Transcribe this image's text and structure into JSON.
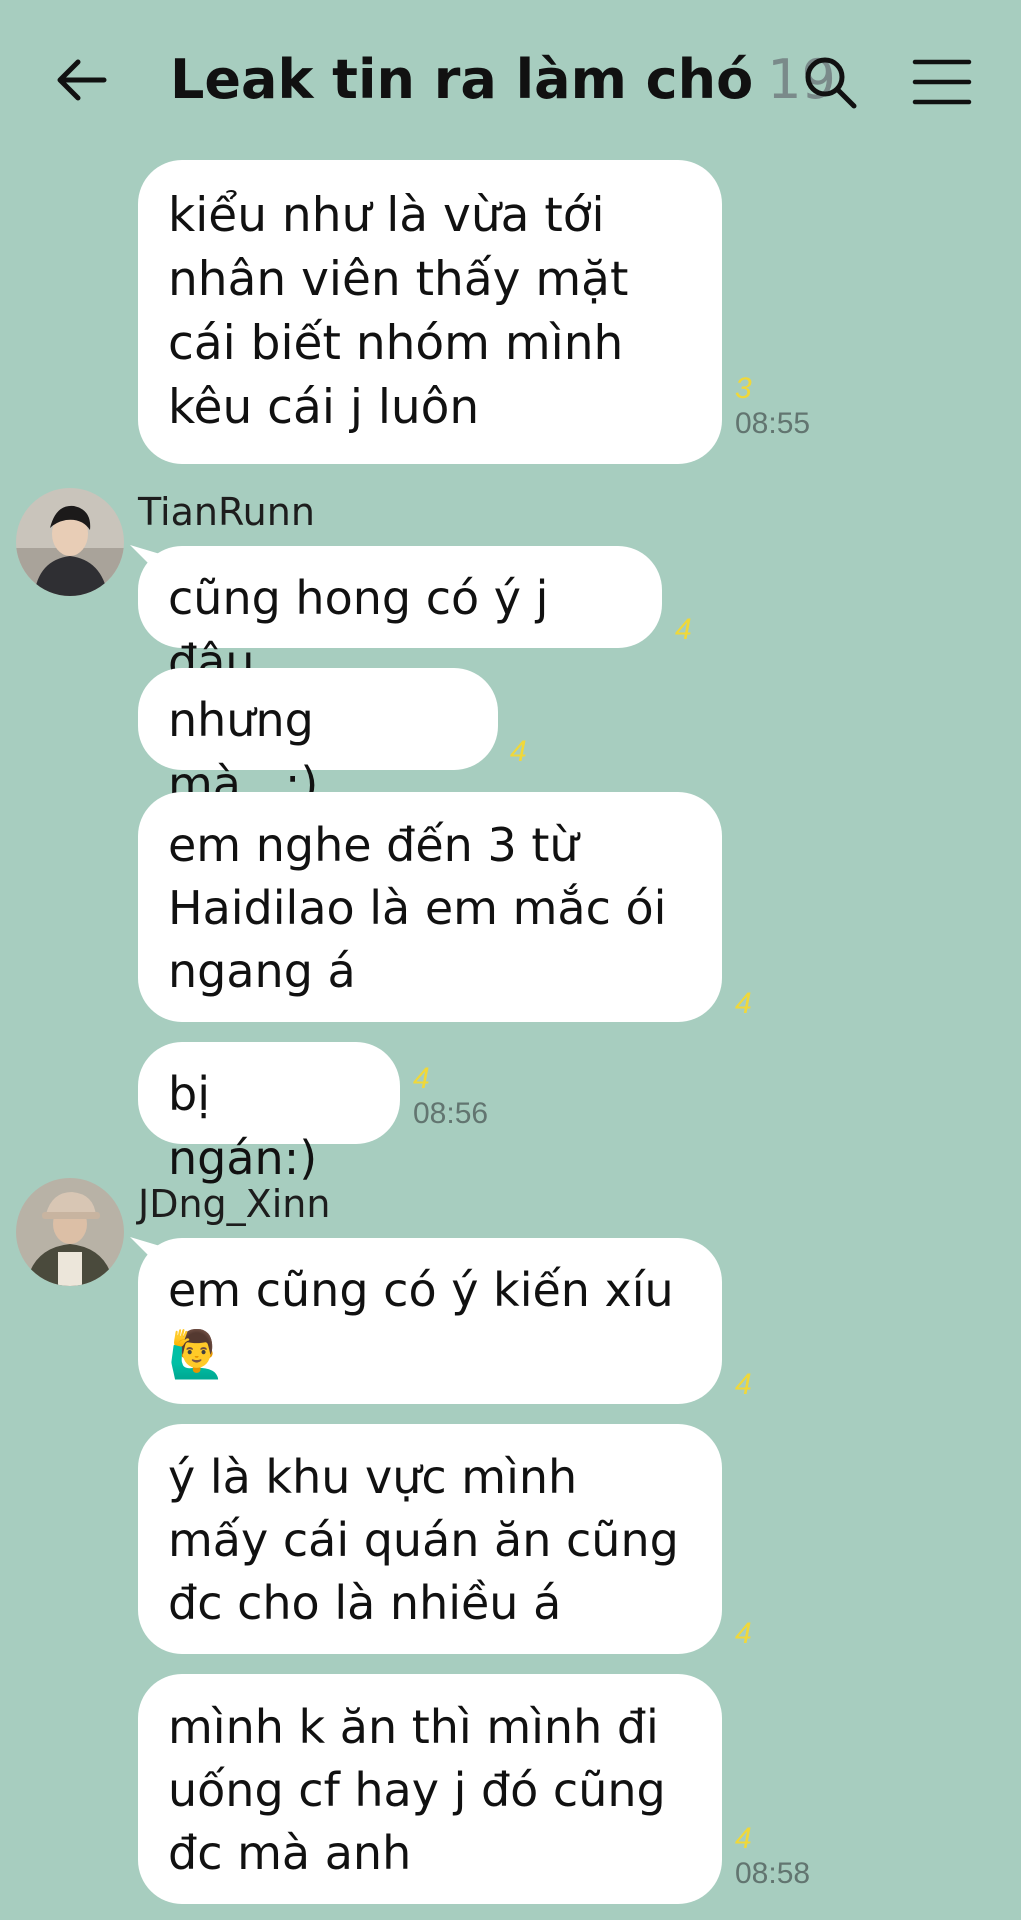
{
  "header": {
    "title": "Leak tin ra làm chó",
    "member_count": "19",
    "back_icon": "arrow-left-icon",
    "search_icon": "search-icon",
    "menu_icon": "hamburger-menu-icon"
  },
  "messages": [
    {
      "text": "kiểu như là vừa tới nhân viên thấy mặt cái biết nhóm mình kêu cái j luôn",
      "read": "3",
      "time": "08:55"
    },
    {
      "sender": "TianRunn",
      "text": "cũng hong có ý j đâu",
      "read": "4"
    },
    {
      "text": "nhưng mà...:)",
      "read": "4"
    },
    {
      "text": "em nghe đến 3 từ Haidilao là em mắc ói ngang á",
      "read": "4"
    },
    {
      "text": "bị ngán:)",
      "read": "4",
      "time": "08:56"
    },
    {
      "sender": "JDng_Xinn",
      "text": "em cũng có ý kiến xíu 🙋‍♂️",
      "read": "4"
    },
    {
      "text": "ý là khu vực mình mấy cái quán ăn cũng đc cho là nhiều á",
      "read": "4"
    },
    {
      "text": "mình k ăn thì mình đi uống cf hay j đó cũng đc mà anh",
      "read": "4",
      "time": "08:58"
    }
  ],
  "colors": {
    "background": "#a7cdbf",
    "bubble": "#ffffff",
    "read_count": "#f0d83a",
    "timestamp": "#627570"
  }
}
